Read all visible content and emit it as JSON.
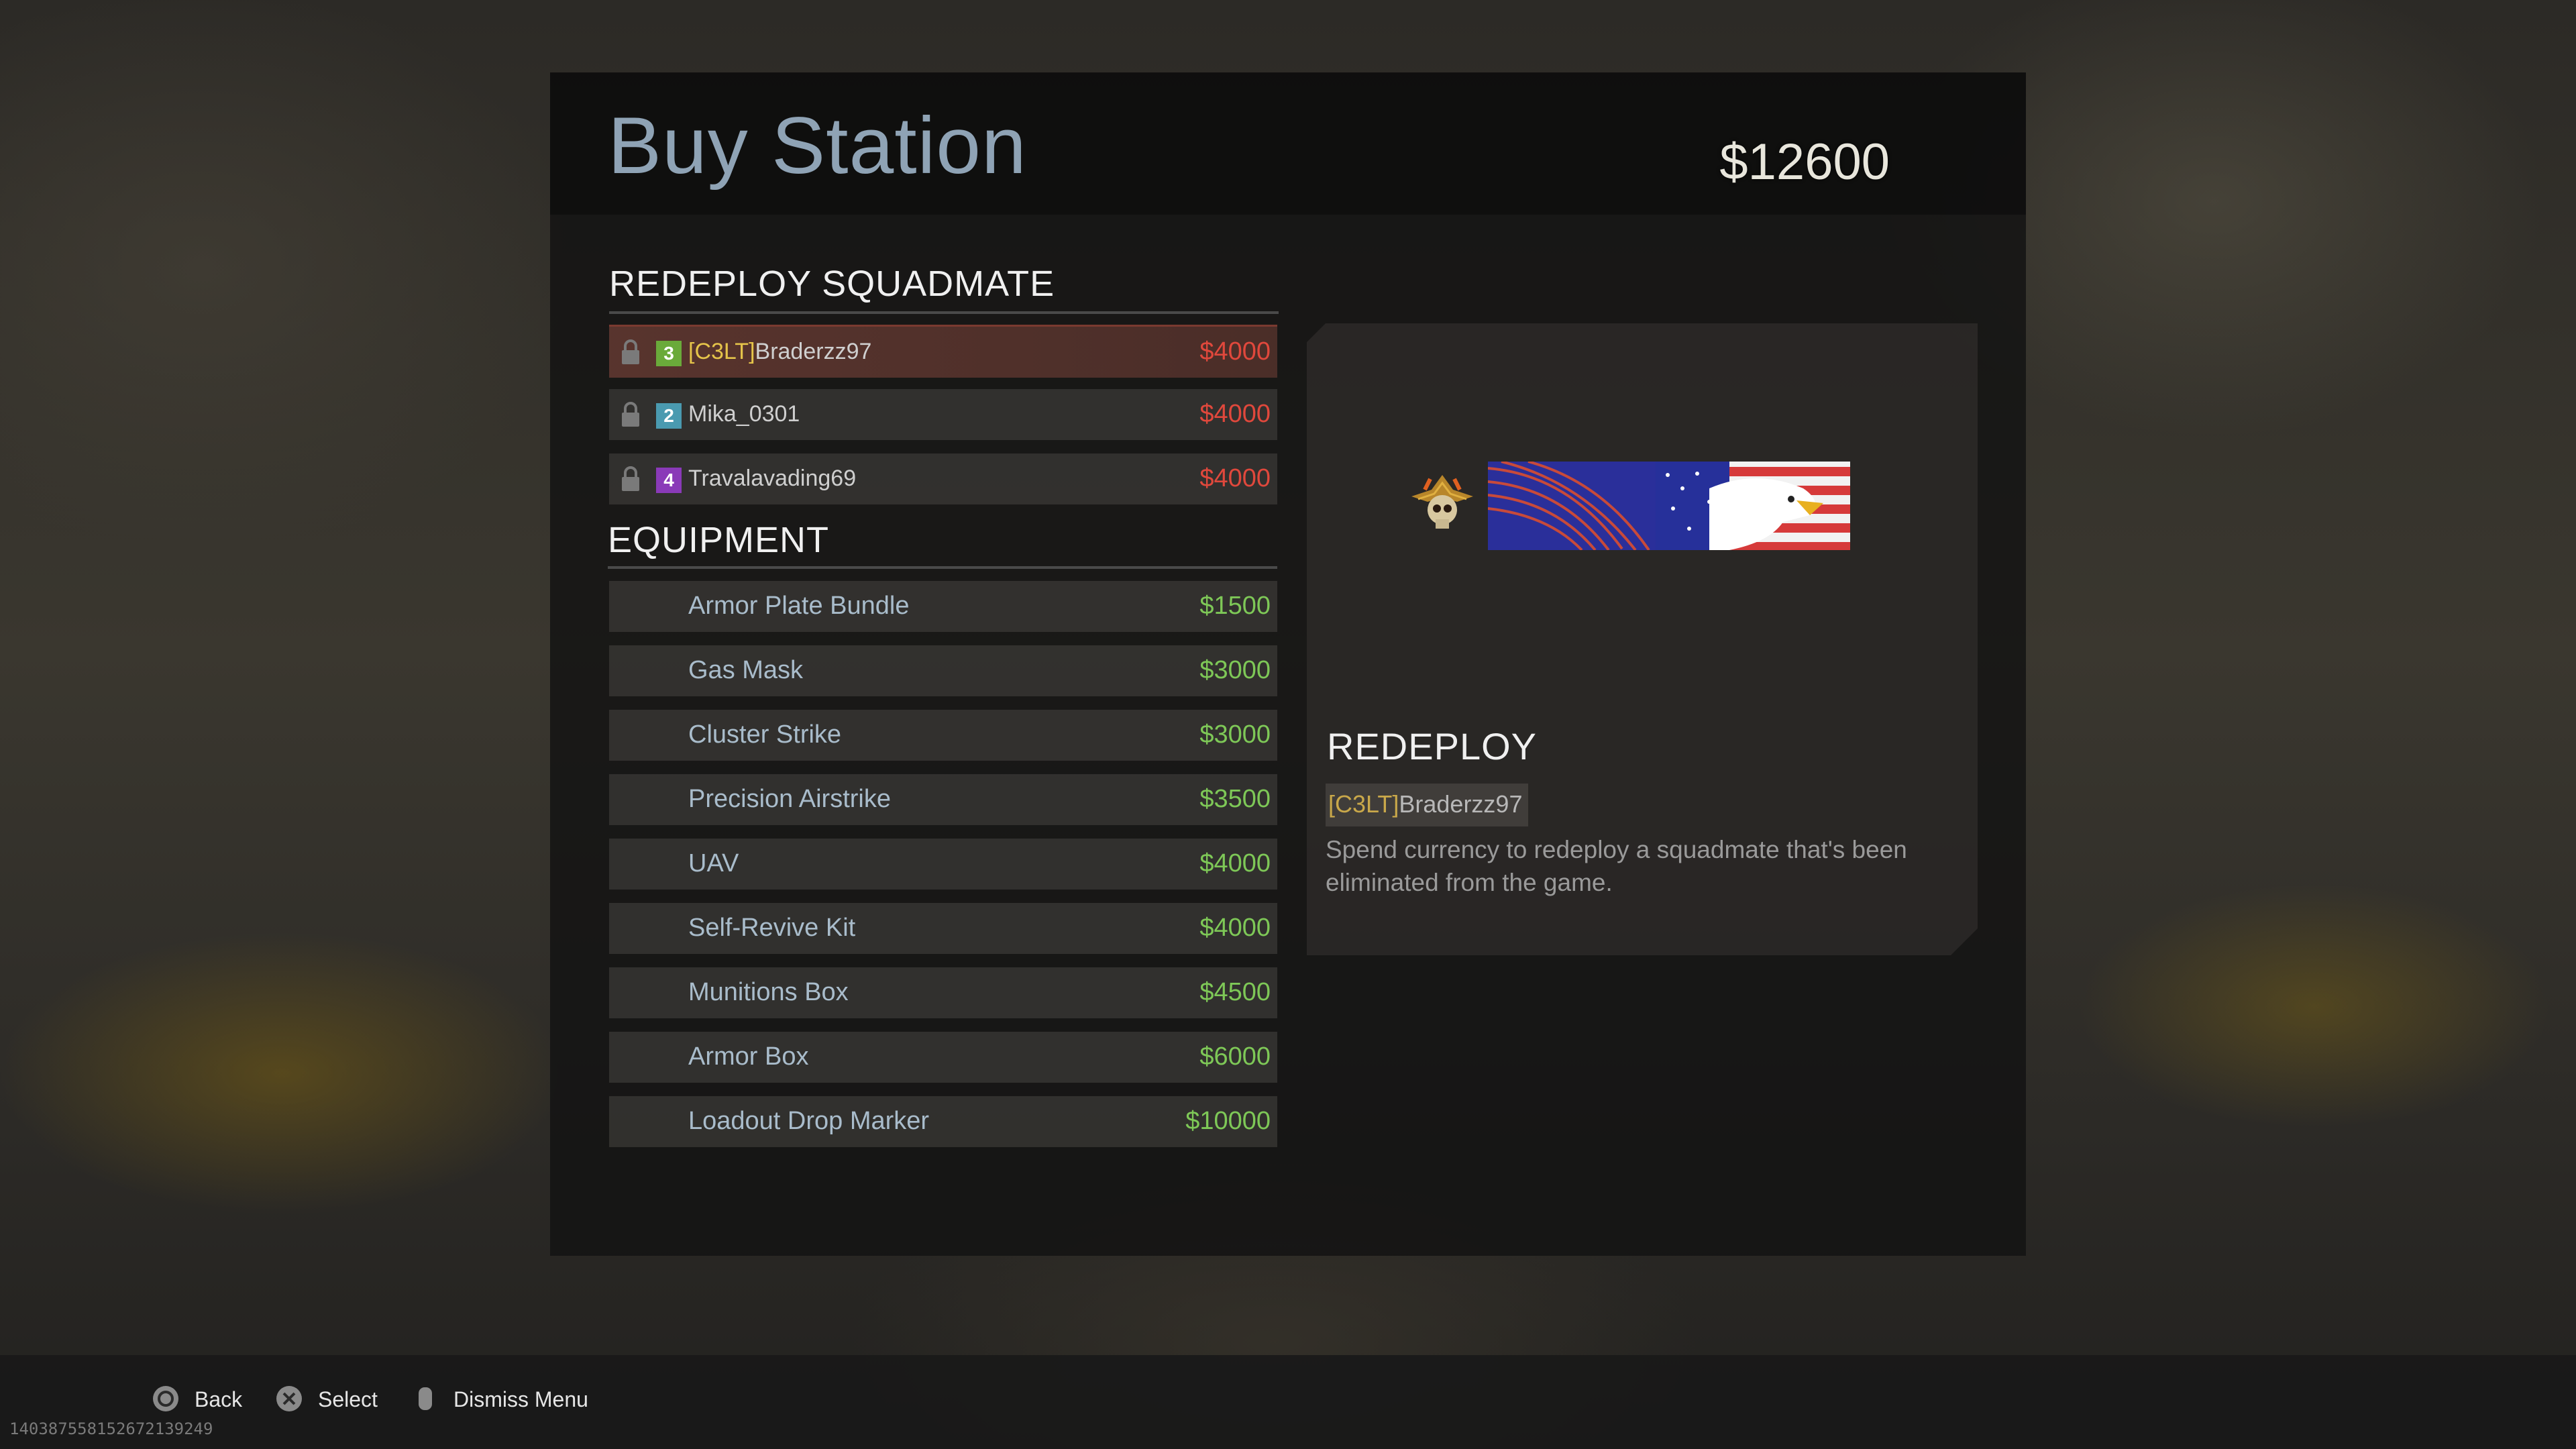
{
  "header": {
    "title": "Buy Station",
    "currency": "$12600"
  },
  "redeploy_section": {
    "title": "REDEPLOY SQUADMATE",
    "squadmates": [
      {
        "number": "3",
        "clan": "[C3LT]",
        "name": "Braderzz97",
        "price": "$4000",
        "color": "#6aaa3a",
        "selected": true
      },
      {
        "number": "2",
        "clan": "",
        "name": "Mika_0301",
        "price": "$4000",
        "color": "#4a9ab0",
        "selected": false
      },
      {
        "number": "4",
        "clan": "",
        "name": "Travalavading69",
        "price": "$4000",
        "color": "#8a3ab8",
        "selected": false
      }
    ]
  },
  "equipment_section": {
    "title": "EQUIPMENT",
    "items": [
      {
        "name": "Armor Plate Bundle",
        "price": "$1500"
      },
      {
        "name": "Gas Mask",
        "price": "$3000"
      },
      {
        "name": "Cluster Strike",
        "price": "$3000"
      },
      {
        "name": "Precision Airstrike",
        "price": "$3500"
      },
      {
        "name": "UAV",
        "price": "$4000"
      },
      {
        "name": "Self-Revive Kit",
        "price": "$4000"
      },
      {
        "name": "Munitions Box",
        "price": "$4500"
      },
      {
        "name": "Armor Box",
        "price": "$6000"
      },
      {
        "name": "Loadout Drop Marker",
        "price": "$10000"
      }
    ]
  },
  "detail": {
    "title": "REDEPLOY",
    "player_clan": "[C3LT]",
    "player_name": "Braderzz97",
    "description": "Spend currency to redeploy a squadmate that's been eliminated from the game."
  },
  "footer": {
    "back_label": "Back",
    "select_label": "Select",
    "dismiss_label": "Dismiss Menu",
    "build_id": "14038755815267213924​9"
  },
  "colors": {
    "price_red": "#e0483c",
    "price_green": "#7ec857",
    "clan_gold": "#e5c44a",
    "title_blue": "#8fa3b5"
  }
}
